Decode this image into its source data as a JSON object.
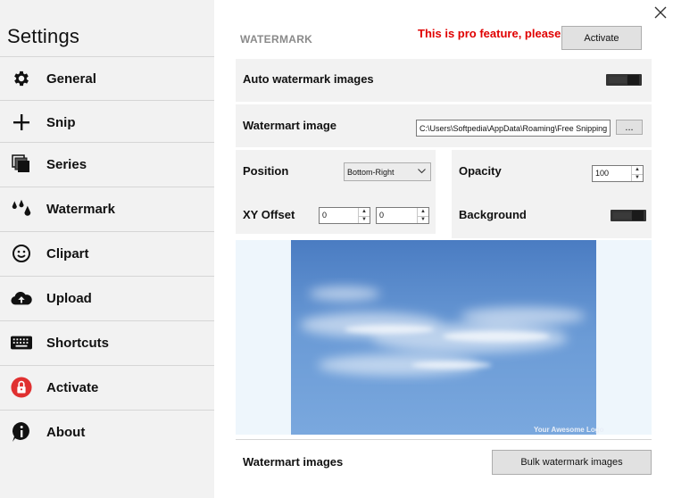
{
  "sidebar": {
    "title": "Settings",
    "items": [
      {
        "label": "General",
        "icon": "gear-icon"
      },
      {
        "label": "Snip",
        "icon": "plus-icon"
      },
      {
        "label": "Series",
        "icon": "stacked-windows-icon"
      },
      {
        "label": "Watermark",
        "icon": "drops-icon"
      },
      {
        "label": "Clipart",
        "icon": "smiley-icon"
      },
      {
        "label": "Upload",
        "icon": "cloud-upload-icon"
      },
      {
        "label": "Shortcuts",
        "icon": "keyboard-icon"
      },
      {
        "label": "Activate",
        "icon": "lock-icon"
      },
      {
        "label": "About",
        "icon": "info-icon"
      }
    ]
  },
  "main": {
    "section_title": "WATERMARK",
    "pro_note": "This is pro feature, please",
    "activate_label": "Activate",
    "auto_watermark_label": "Auto watermark images",
    "auto_watermark_on": false,
    "watermark_image_label": "Watermart image",
    "watermark_image_path": "C:\\Users\\Softpedia\\AppData\\Roaming\\Free Snipping",
    "browse_label": "...",
    "position_label": "Position",
    "position_value": "Bottom-Right",
    "opacity_label": "Opacity",
    "opacity_value": "100",
    "xy_offset_label": "XY Offset",
    "x_offset_value": "0",
    "y_offset_value": "0",
    "background_label": "Background",
    "background_on": false,
    "preview_logo_text": "Your Awesome Logo",
    "bulk_label": "Watermart images",
    "bulk_button_label": "Bulk watermark images"
  },
  "colors": {
    "sidebar_bg": "#f2f2f2",
    "pro_note": "#e00000",
    "row_bg": "#f2f2f2",
    "activate_icon": "#e03030"
  }
}
